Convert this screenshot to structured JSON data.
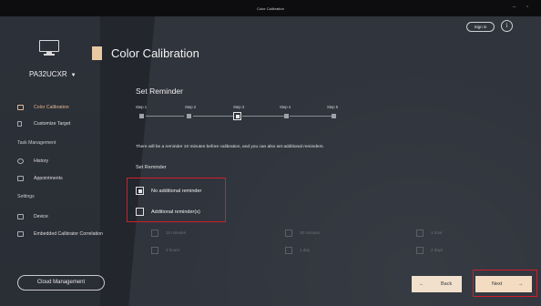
{
  "window": {
    "title": "Color Calibration",
    "minimize": "–",
    "maximize": "▫"
  },
  "header": {
    "sign_in": "Sign in",
    "info": "i"
  },
  "sidebar": {
    "device_name": "PA32UCXR",
    "device_caret": "▼",
    "items": [
      {
        "label": "Color Calibration",
        "active": true
      },
      {
        "label": "Customize Target"
      }
    ],
    "section_task": "Task Management",
    "task_items": [
      {
        "label": "History"
      },
      {
        "label": "Appointments"
      }
    ],
    "section_settings": "Settings",
    "settings_items": [
      {
        "label": "Device"
      },
      {
        "label": "Embedded Calibrator Correlation"
      }
    ],
    "cloud_button": "Cloud Management"
  },
  "main": {
    "page_title": "Color Calibration",
    "section_title": "Set Reminder",
    "steps": [
      {
        "label": "Step 1"
      },
      {
        "label": "Step 2"
      },
      {
        "label": "Step 3",
        "current": true
      },
      {
        "label": "Step 4"
      },
      {
        "label": "Step 5"
      }
    ],
    "description": "There will be a reminder 10 minutes before calibration, and you can also set additional reminders.",
    "set_reminder_label": "Set Reminder",
    "options": [
      {
        "label": "No additional reminder",
        "checked": true
      },
      {
        "label": "Additional reminder(s)",
        "checked": false
      }
    ],
    "sub_options": [
      "15 minutes",
      "30 minutes",
      "1 hour",
      "2 hours",
      "1 day",
      "2 days"
    ],
    "back_label": "Back",
    "back_arrow": "←",
    "next_label": "Next",
    "next_arrow": "→"
  },
  "colors": {
    "accent": "#e8c9a3",
    "highlight": "#d11f2c",
    "background": "#30343c"
  }
}
